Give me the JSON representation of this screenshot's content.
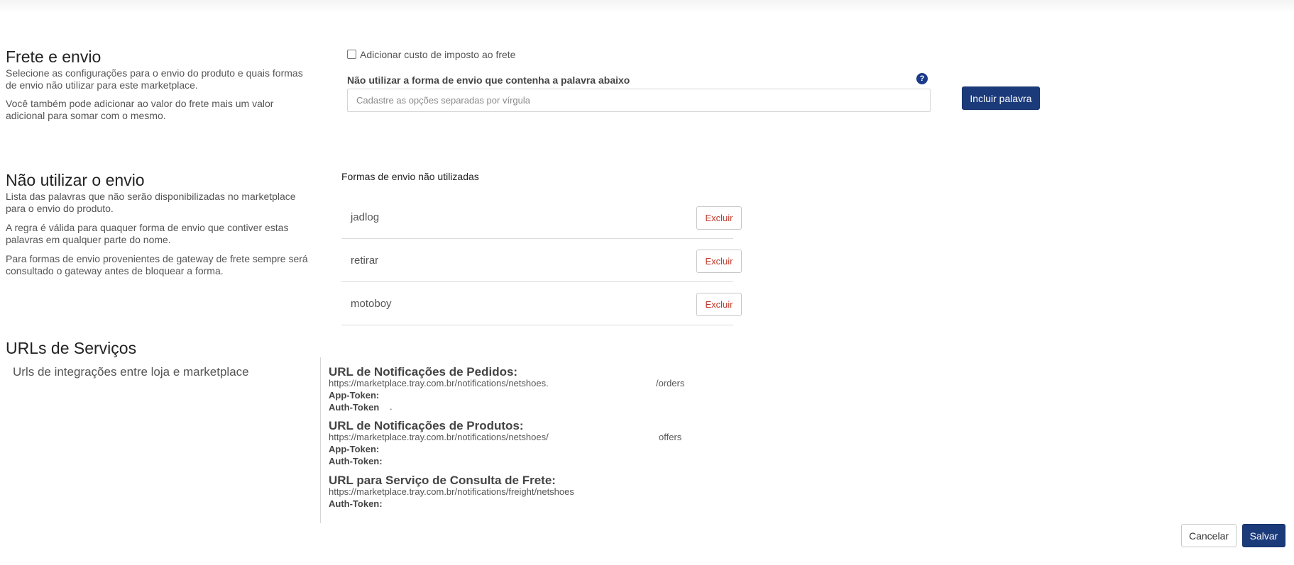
{
  "frete": {
    "title": "Frete e envio",
    "desc1": "Selecione as configurações para o envio do produto e quais formas de envio não utilizar para este marketplace.",
    "desc2": "Você também pode adicionar ao valor do frete mais um valor adicional para somar com o mesmo.",
    "checkbox_label": "Adicionar custo de imposto ao frete",
    "checkbox_checked": false,
    "field_label": "Não utilizar a forma de envio que contenha a palavra abaixo",
    "input_value": "",
    "input_placeholder": "Cadastre as opções separadas por vírgula",
    "help_icon": "?",
    "include_button": "Incluir palavra"
  },
  "nao_utilizar": {
    "title": "Não utilizar o envio",
    "desc1": "Lista das palavras que não serão disponibilizadas no marketplace para o envio do produto.",
    "desc2": "A regra é válida para quaquer forma de envio que contiver estas palavras em qualquer parte do nome.",
    "desc3": "Para formas de envio provenientes de gateway de frete sempre será consultado o gateway antes de bloquear a forma.",
    "list_heading": "Formas de envio não utilizadas",
    "items": [
      {
        "label": "jadlog",
        "button": "Excluir"
      },
      {
        "label": "retirar",
        "button": "Excluir"
      },
      {
        "label": "motoboy",
        "button": "Excluir"
      }
    ]
  },
  "urls": {
    "title": "URLs de Serviços",
    "subtitle": "Urls de integrações entre loja e marketplace",
    "pedidos": {
      "title": "URL de Notificações de Pedidos:",
      "url_prefix": "https://marketplace.tray.com.br/notifications/netshoes.",
      "url_suffix": "/orders",
      "app_token_label": "App-Token:",
      "auth_token_label": "Auth-Token",
      "auth_token_value": "."
    },
    "produtos": {
      "title": "URL de Notificações de Produtos:",
      "url_prefix": "https://marketplace.tray.com.br/notifications/netshoes/",
      "url_suffix": "offers",
      "app_token_label": "App-Token:",
      "auth_token_label": "Auth-Token:"
    },
    "frete": {
      "title": "URL para Serviço de Consulta de Frete:",
      "url": "https://marketplace.tray.com.br/notifications/freight/netshoes",
      "auth_token_label": "Auth-Token:"
    }
  },
  "footer": {
    "cancel": "Cancelar",
    "save": "Salvar"
  },
  "colors": {
    "primary": "#1b3a7a",
    "danger": "#c0392b"
  }
}
